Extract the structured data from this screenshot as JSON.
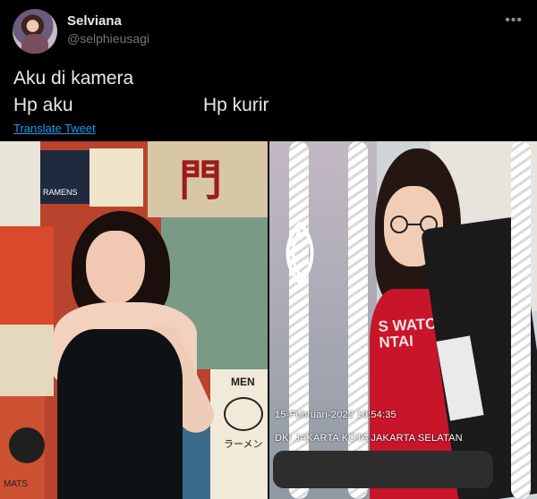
{
  "tweet": {
    "author_name": "Selviana",
    "author_handle": "@selphieusagi",
    "more_icon": "more-horizontal-icon",
    "text_line1": "Aku di kamera",
    "text_line2_left": "Hp aku",
    "text_line2_right": "Hp kurir",
    "translate_label": "Translate Tweet"
  },
  "media": {
    "left_photo": {
      "poster_texts": [
        "RAMENS",
        "門",
        "MEN",
        "ラーメン",
        "MATS"
      ]
    },
    "right_photo": {
      "shirt_text": "S WATC\nNTAI",
      "timestamp": "15-Februari-2022 10:54:35",
      "location": "DKI JAKARTA KOTA JAKARTA SELATAN"
    }
  },
  "colors": {
    "background": "#000000",
    "text_primary": "#e7e9ea",
    "text_secondary": "#71767b",
    "link": "#1d9bf0"
  }
}
